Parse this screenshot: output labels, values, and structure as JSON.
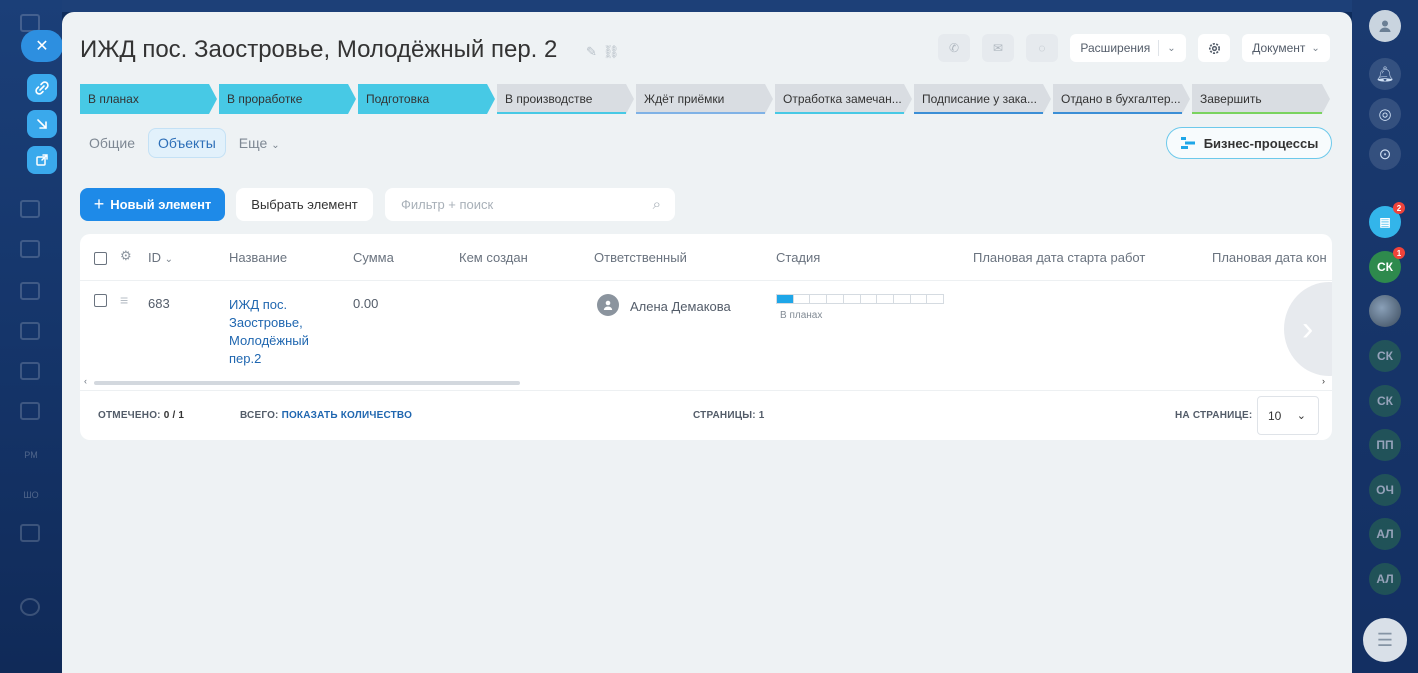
{
  "title": "ИЖД пос. Заостровье, Молодёжный пер. 2",
  "header": {
    "extensions_label": "Расширения",
    "document_label": "Документ"
  },
  "stages": [
    {
      "label": "В планах",
      "state": "active",
      "line": "#47c9e5"
    },
    {
      "label": "В проработке",
      "state": "active",
      "line": "#47c9e5"
    },
    {
      "label": "Подготовка",
      "state": "active",
      "line": "#47c9e5"
    },
    {
      "label": "В производстве",
      "state": "inactive",
      "line": "#47c9e5"
    },
    {
      "label": "Ждёт приёмки",
      "state": "inactive",
      "line": "#7fb2e6"
    },
    {
      "label": "Отработка замечан...",
      "state": "inactive",
      "line": "#47c9e5"
    },
    {
      "label": "Подписание у зака...",
      "state": "inactive",
      "line": "#3b8fd6"
    },
    {
      "label": "Отдано в бухгалтер...",
      "state": "inactive",
      "line": "#3b8fd6"
    },
    {
      "label": "Завершить",
      "state": "inactive",
      "line": "#7ad35f"
    }
  ],
  "tabs": {
    "general": "Общие",
    "objects": "Объекты",
    "more": "Еще"
  },
  "business_processes_label": "Бизнес-процессы",
  "toolbar": {
    "new_label": "Новый элемент",
    "select_label": "Выбрать элемент",
    "search_placeholder": "Фильтр + поиск"
  },
  "table": {
    "columns": {
      "id": "ID",
      "name": "Название",
      "sum": "Сумма",
      "created_by": "Кем создан",
      "responsible": "Ответственный",
      "stage": "Стадия",
      "planned_start": "Плановая дата старта работ",
      "planned_end": "Плановая дата кон"
    },
    "rows": [
      {
        "id": "683",
        "name_lines": [
          "ИЖД пос.",
          "Заостровье,",
          "Молодёжный",
          "пер.2"
        ],
        "sum": "0.00",
        "responsible": "Алена Демакова",
        "stage_label": "В планах",
        "stage_progress": 0.1
      }
    ]
  },
  "footer": {
    "checked_label": "ОТМЕЧЕНО:",
    "checked_value": "0 / 1",
    "total_label": "ВСЕГО:",
    "total_link": "ПОКАЗАТЬ КОЛИЧЕСТВО",
    "pages_label": "СТРАНИЦЫ:",
    "pages_value": "1",
    "per_page_label": "НА СТРАНИЦЕ:",
    "per_page_value": "10"
  },
  "right_sidebar": {
    "avatars": [
      {
        "initials": "СК",
        "badge": "1"
      },
      {
        "initials": "СК"
      },
      {
        "initials": "СК"
      },
      {
        "initials": "ПП"
      },
      {
        "initials": "ОЧ"
      },
      {
        "initials": "АЛ"
      },
      {
        "initials": "АЛ"
      }
    ],
    "chat_badge": "2"
  },
  "left_sidebar": {
    "ghost_labels": [
      "PM",
      "ШО"
    ]
  }
}
